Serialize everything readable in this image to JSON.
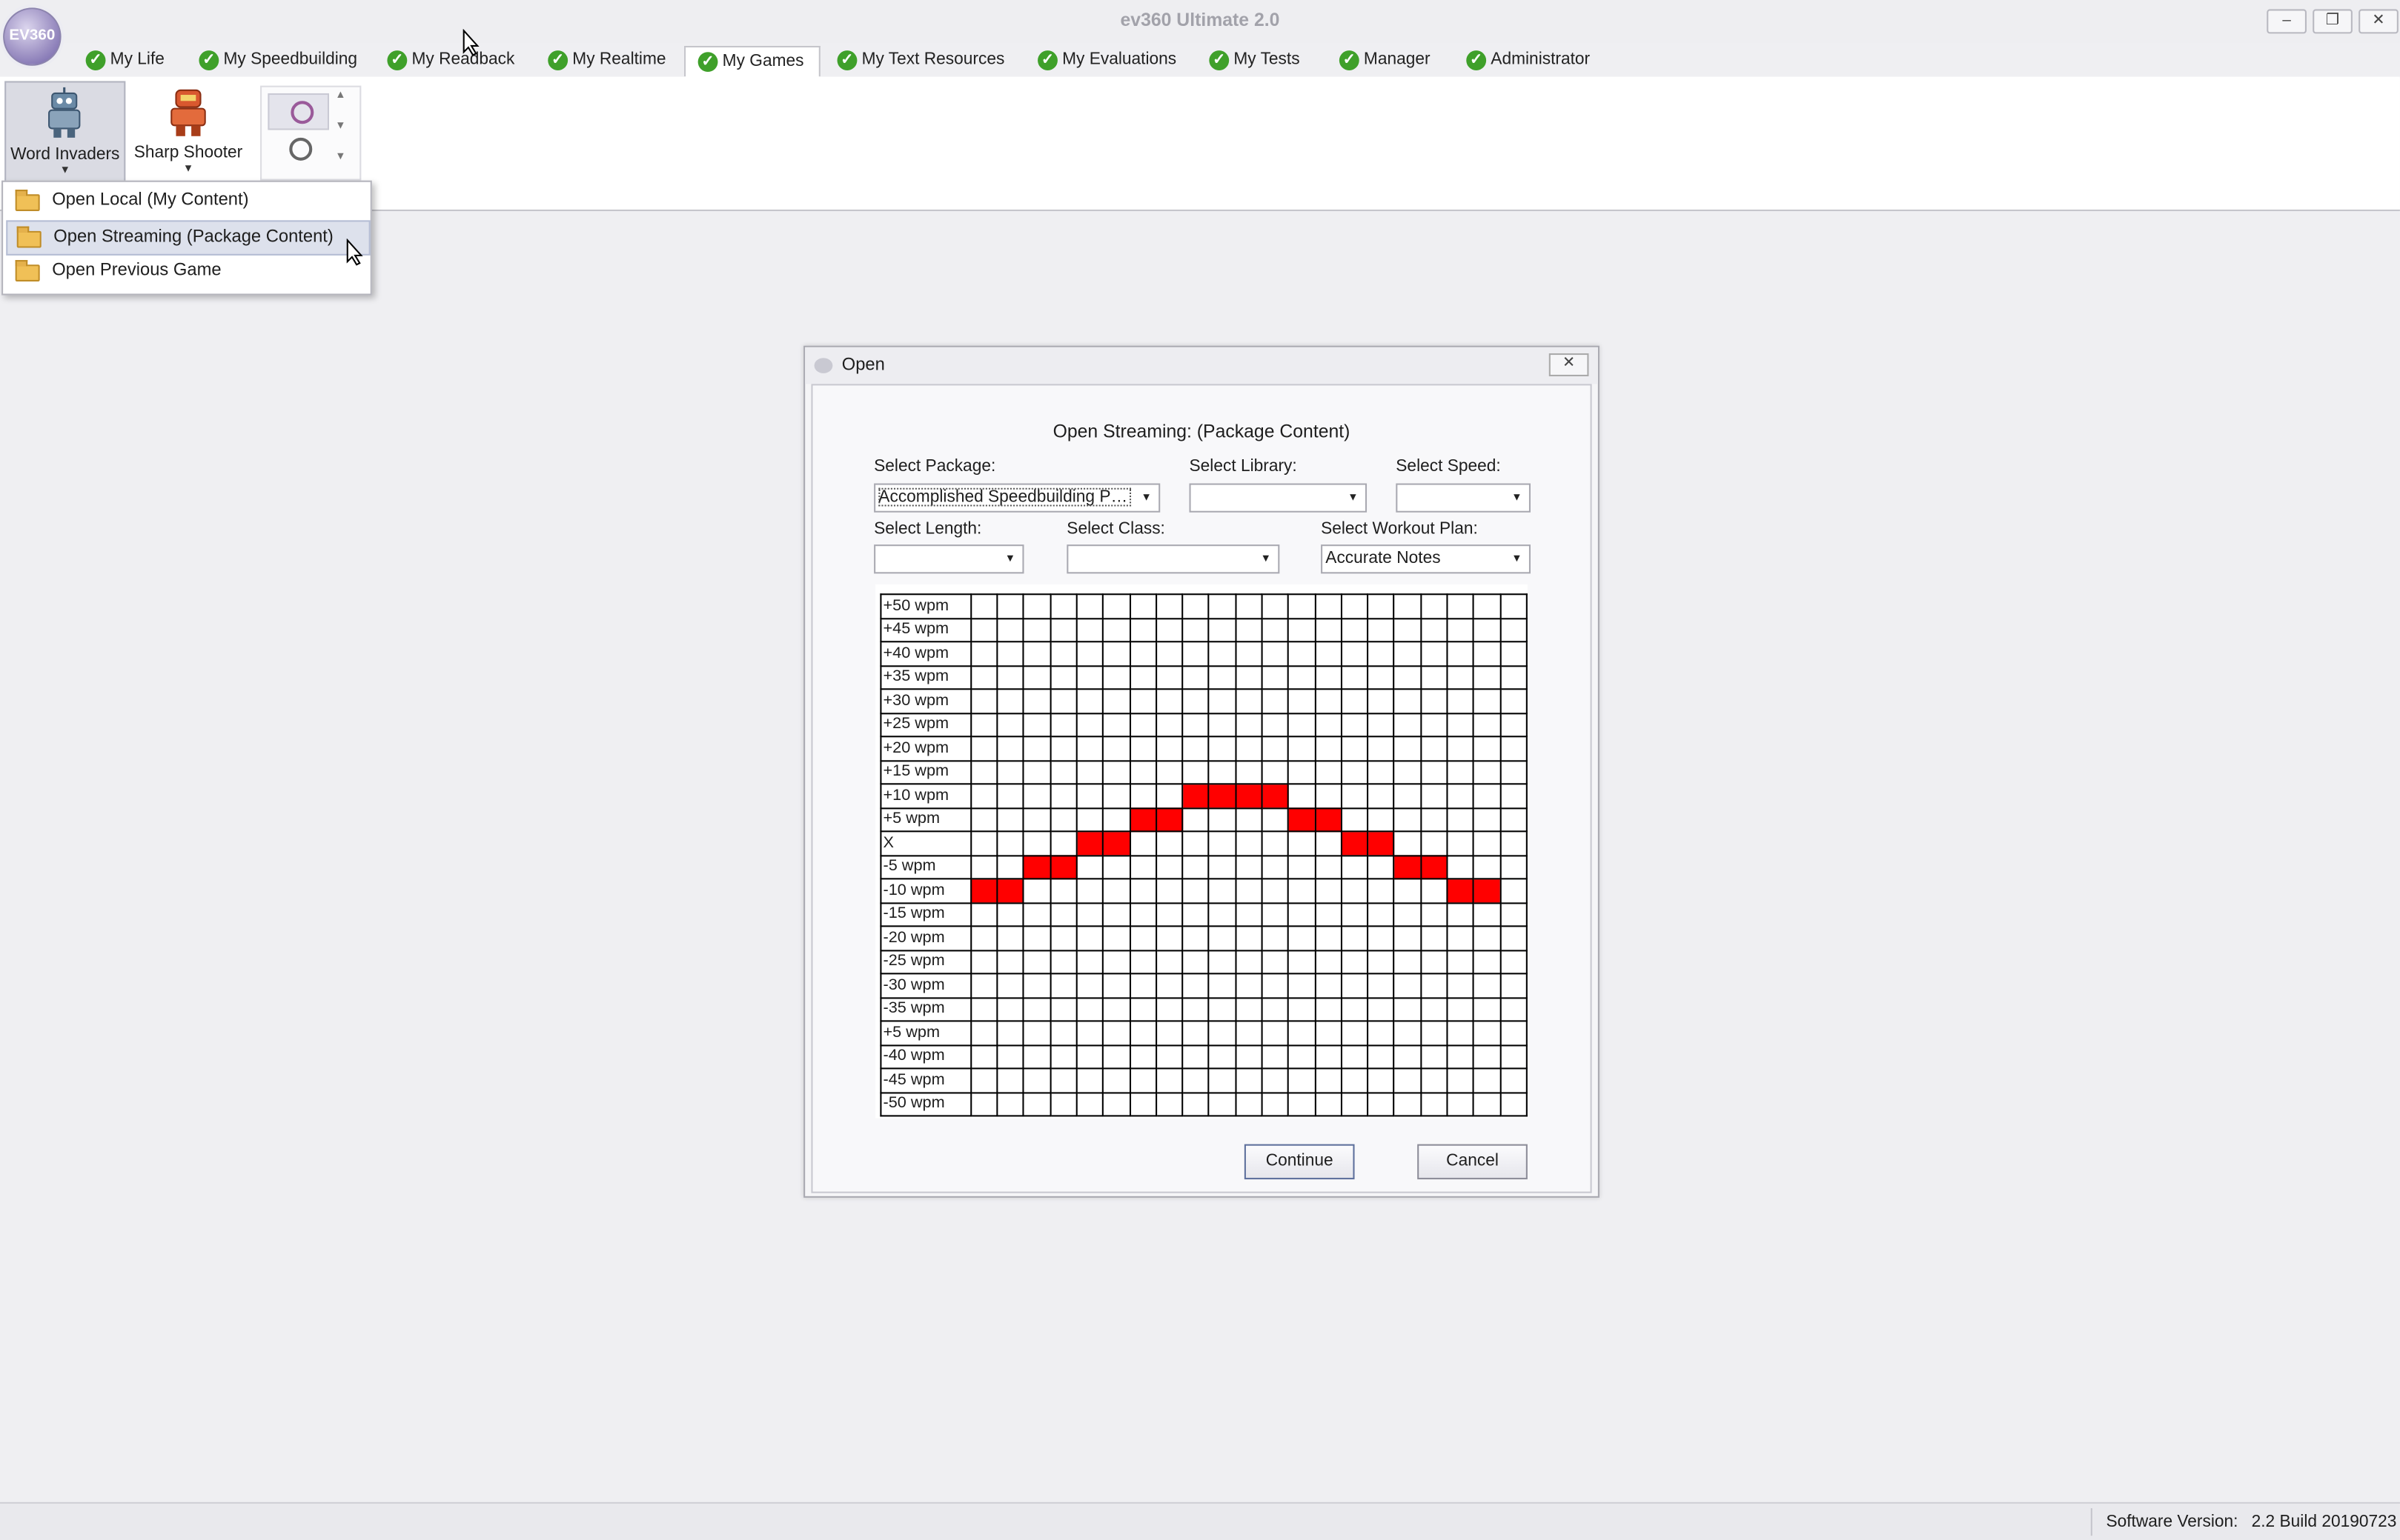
{
  "window": {
    "title": "ev360 Ultimate 2.0",
    "logo_text": "EV360",
    "minimize": "–",
    "restore": "❐",
    "close": "✕"
  },
  "tabs": [
    {
      "label": "My Life",
      "active": false
    },
    {
      "label": "My Speedbuilding",
      "active": false
    },
    {
      "label": "My Readback",
      "active": false
    },
    {
      "label": "My Realtime",
      "active": false
    },
    {
      "label": "My Games",
      "active": true
    },
    {
      "label": "My Text Resources",
      "active": false
    },
    {
      "label": "My Evaluations",
      "active": false
    },
    {
      "label": "My Tests",
      "active": false
    },
    {
      "label": "Manager",
      "active": false
    },
    {
      "label": "Administrator",
      "active": false
    }
  ],
  "ribbon": {
    "word_invaders": "Word Invaders",
    "sharp_shooter": "Sharp Shooter",
    "gallery_icons": [
      "badge-icon",
      "badge-icon"
    ]
  },
  "menu": {
    "items": [
      {
        "label": "Open Local (My Content)",
        "icon": "folder-icon",
        "highlighted": false
      },
      {
        "label": "Open Streaming (Package Content)",
        "icon": "folder-icon",
        "highlighted": true
      },
      {
        "label": "Open Previous Game",
        "icon": "folder-icon",
        "highlighted": false
      }
    ]
  },
  "dialog": {
    "title": "Open",
    "heading": "Open Streaming: (Package Content)",
    "fields": {
      "package": {
        "label": "Select Package:",
        "value": "Accomplished Speedbuilding Pac..."
      },
      "library": {
        "label": "Select Library:",
        "value": ""
      },
      "speed": {
        "label": "Select Speed:",
        "value": ""
      },
      "length": {
        "label": "Select Length:",
        "value": ""
      },
      "class": {
        "label": "Select Class:",
        "value": ""
      },
      "workout_plan": {
        "label": "Select Workout Plan:",
        "value": "Accurate Notes"
      }
    },
    "grid": {
      "row_labels": [
        "+50 wpm",
        "+45 wpm",
        "+40 wpm",
        "+35 wpm",
        "+30 wpm",
        "+25 wpm",
        "+20 wpm",
        "+15 wpm",
        "+10 wpm",
        "+5 wpm",
        "X",
        "-5 wpm",
        "-10 wpm",
        "-15 wpm",
        "-20 wpm",
        "-25 wpm",
        "-30 wpm",
        "-35 wpm",
        "+5 wpm",
        "-40 wpm",
        "-45 wpm",
        "-50 wpm"
      ],
      "column_count": 21,
      "filled": [
        {
          "row": "-10 wpm",
          "cols": [
            0,
            1
          ]
        },
        {
          "row": "-5 wpm",
          "cols": [
            2,
            3
          ]
        },
        {
          "row": "X",
          "cols": [
            4,
            5
          ]
        },
        {
          "row": "+5 wpm",
          "cols": [
            6,
            7
          ]
        },
        {
          "row": "+10 wpm",
          "cols": [
            8,
            9,
            10,
            11
          ]
        },
        {
          "row": "+5 wpm",
          "cols": [
            12,
            13
          ]
        },
        {
          "row": "X",
          "cols": [
            14,
            15
          ]
        },
        {
          "row": "-5 wpm",
          "cols": [
            16,
            17
          ]
        },
        {
          "row": "-10 wpm",
          "cols": [
            18,
            19
          ]
        }
      ],
      "fill_color": "#ff0000"
    },
    "continue": "Continue",
    "cancel": "Cancel"
  },
  "status": {
    "label": "Software Version:",
    "value": "2.2 Build 20190723"
  },
  "colors": {
    "accent_check": "#3fa02a",
    "menu_highlight": "#dde1ec"
  }
}
